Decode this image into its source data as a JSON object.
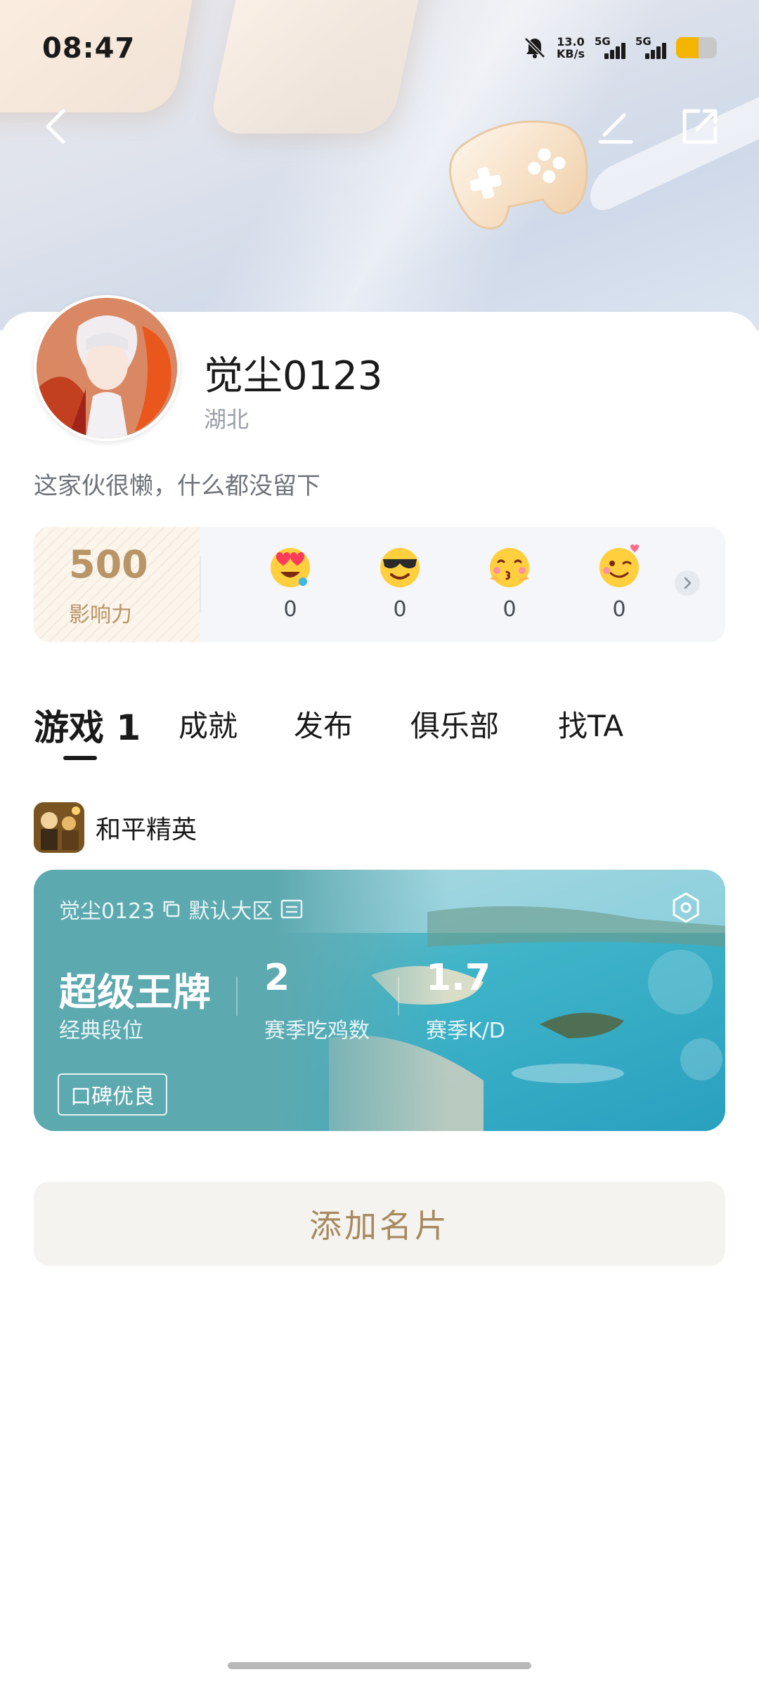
{
  "status_bar": {
    "time": "08:47",
    "net_speed_value": "13.0",
    "net_speed_unit": "KB/s",
    "sim1": "5G",
    "sim2": "5G",
    "battery_level": 0.55,
    "battery_color": "#f4b400"
  },
  "header": {
    "back_icon": "chevron-left-icon",
    "edit_icon": "pencil-icon",
    "share_icon": "share-out-icon"
  },
  "profile": {
    "username": "觉尘0123",
    "region": "湖北",
    "bio": "这家伙很懒，什么都没留下"
  },
  "influence": {
    "value": "500",
    "label": "影响力",
    "reactions": [
      {
        "icon": "heart-eyes-emoji-icon",
        "count": "0"
      },
      {
        "icon": "sunglasses-emoji-icon",
        "count": "0"
      },
      {
        "icon": "kiss-emoji-icon",
        "count": "0"
      },
      {
        "icon": "wink-emoji-icon",
        "count": "0"
      }
    ]
  },
  "tabs": [
    {
      "label": "游戏 1",
      "active": true
    },
    {
      "label": "成就",
      "active": false
    },
    {
      "label": "发布",
      "active": false
    },
    {
      "label": "俱乐部",
      "active": false
    },
    {
      "label": "找TA",
      "active": false
    }
  ],
  "game": {
    "name": "和平精英",
    "card": {
      "player_name": "觉尘0123",
      "server": "默认大区",
      "rank": "超级王牌",
      "rank_label": "经典段位",
      "wins": "2",
      "wins_label": "赛季吃鸡数",
      "kd": "1.7",
      "kd_label": "赛季K/D",
      "badge": "口碑优良"
    }
  },
  "actions": {
    "add_card": "添加名片"
  },
  "colors": {
    "accent_gold": "#b89466",
    "card_teal": "#5da9b0"
  }
}
